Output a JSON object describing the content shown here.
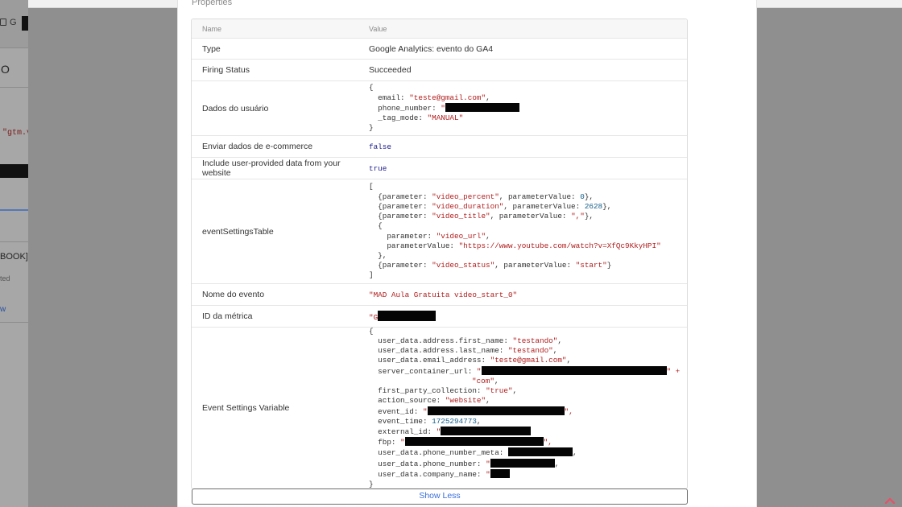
{
  "left_partial": {
    "tab_prefix": "G",
    "heading_char": "O",
    "code_snippet": "\"gtm.v",
    "label_book": "BOOK][",
    "status_fragment": "ted",
    "link_fragment": "w"
  },
  "section_title": "Properties",
  "table": {
    "header": {
      "name": "Name",
      "value": "Value"
    },
    "rows": {
      "type": {
        "name": "Type",
        "value": "Google Analytics: evento do GA4"
      },
      "firing_status": {
        "name": "Firing Status",
        "value": "Succeeded"
      },
      "dados_usuario": {
        "name": "Dados do usuário",
        "lines": {
          "open": "{",
          "email_key": "  email: ",
          "email_val": "\"teste@gmail.com\"",
          "email_comma": ",",
          "phone_key": "  phone_number: ",
          "phone_val_prefix": "\"",
          "tag_key": "  _tag_mode: ",
          "tag_val": "\"MANUAL\"",
          "close": "}"
        }
      },
      "ecommerce": {
        "name": "Enviar dados de e-commerce",
        "value": "false"
      },
      "user_provided": {
        "name": "Include user-provided data from your website",
        "value": "true"
      },
      "event_settings_table": {
        "name": "eventSettingsTable",
        "lines": {
          "open": "[",
          "l1a": "  {parameter: ",
          "l1b": "\"video_percent\"",
          "l1c": ", parameterValue: ",
          "l1d": "0",
          "l1e": "},",
          "l2a": "  {parameter: ",
          "l2b": "\"video_duration\"",
          "l2c": ", parameterValue: ",
          "l2d": "2628",
          "l2e": "},",
          "l3a": "  {parameter: ",
          "l3b": "\"video_title\"",
          "l3c": ", parameterValue: ",
          "l3d": "\",\"",
          "l3e": "},",
          "l4": "  {",
          "l5a": "    parameter: ",
          "l5b": "\"video_url\"",
          "l5c": ",",
          "l6a": "    parameterValue: ",
          "l6b": "\"https://www.youtube.com/watch?v=XfQc9KkyHPI\"",
          "l7": "  },",
          "l8a": "  {parameter: ",
          "l8b": "\"video_status\"",
          "l8c": ", parameterValue: ",
          "l8d": "\"start\"",
          "l8e": "}",
          "close": "]"
        }
      },
      "nome_evento": {
        "name": "Nome do evento",
        "value": "\"MAD Aula Gratuita video_start_0\""
      },
      "id_metrica": {
        "name": "ID da métrica",
        "value_prefix": "\"G"
      },
      "event_settings_variable": {
        "name": "Event Settings Variable",
        "lines": {
          "open": "{",
          "a1": "  user_data.address.first_name: ",
          "a1v": "\"testando\"",
          "a1c": ",",
          "a2": "  user_data.address.last_name: ",
          "a2v": "\"testando\"",
          "a2c": ",",
          "a3": "  user_data.email_address: ",
          "a3v": "\"teste@gmail.com\"",
          "a3c": ",",
          "a4": "  server_container_url: ",
          "a4v": "\"",
          "a4t": "\" +",
          "a5v": "\"com\"",
          "a5c": ",",
          "a6": "  first_party_collection: ",
          "a6v": "\"true\"",
          "a6c": ",",
          "a7": "  action_source: ",
          "a7v": "\"website\"",
          "a7c": ",",
          "a8": "  event_id: ",
          "a8v": "\"",
          "a8t": "\",",
          "a9": "  event_time: ",
          "a9v": "1725294773",
          "a9c": ",",
          "a10": "  external_id: ",
          "a10v": "\"",
          "a11": "  fbp: ",
          "a11v": "\"",
          "a11t": "\",",
          "a12": "  user_data.phone_number_meta: ",
          "a12t": ",",
          "a13": "  user_data.phone_number: ",
          "a13v": "\"",
          "a13t": ",",
          "a14": "  user_data.company_name: ",
          "a14v": "\"",
          "close": "}"
        }
      }
    }
  },
  "show_less_label": "Show Less",
  "colors": {
    "string": "#b11d1d",
    "keyword": "#1a1a8a",
    "link": "#3a6fd8",
    "redaction": "#050505"
  },
  "icons": {
    "scroll_top": "chevron-up-icon"
  }
}
